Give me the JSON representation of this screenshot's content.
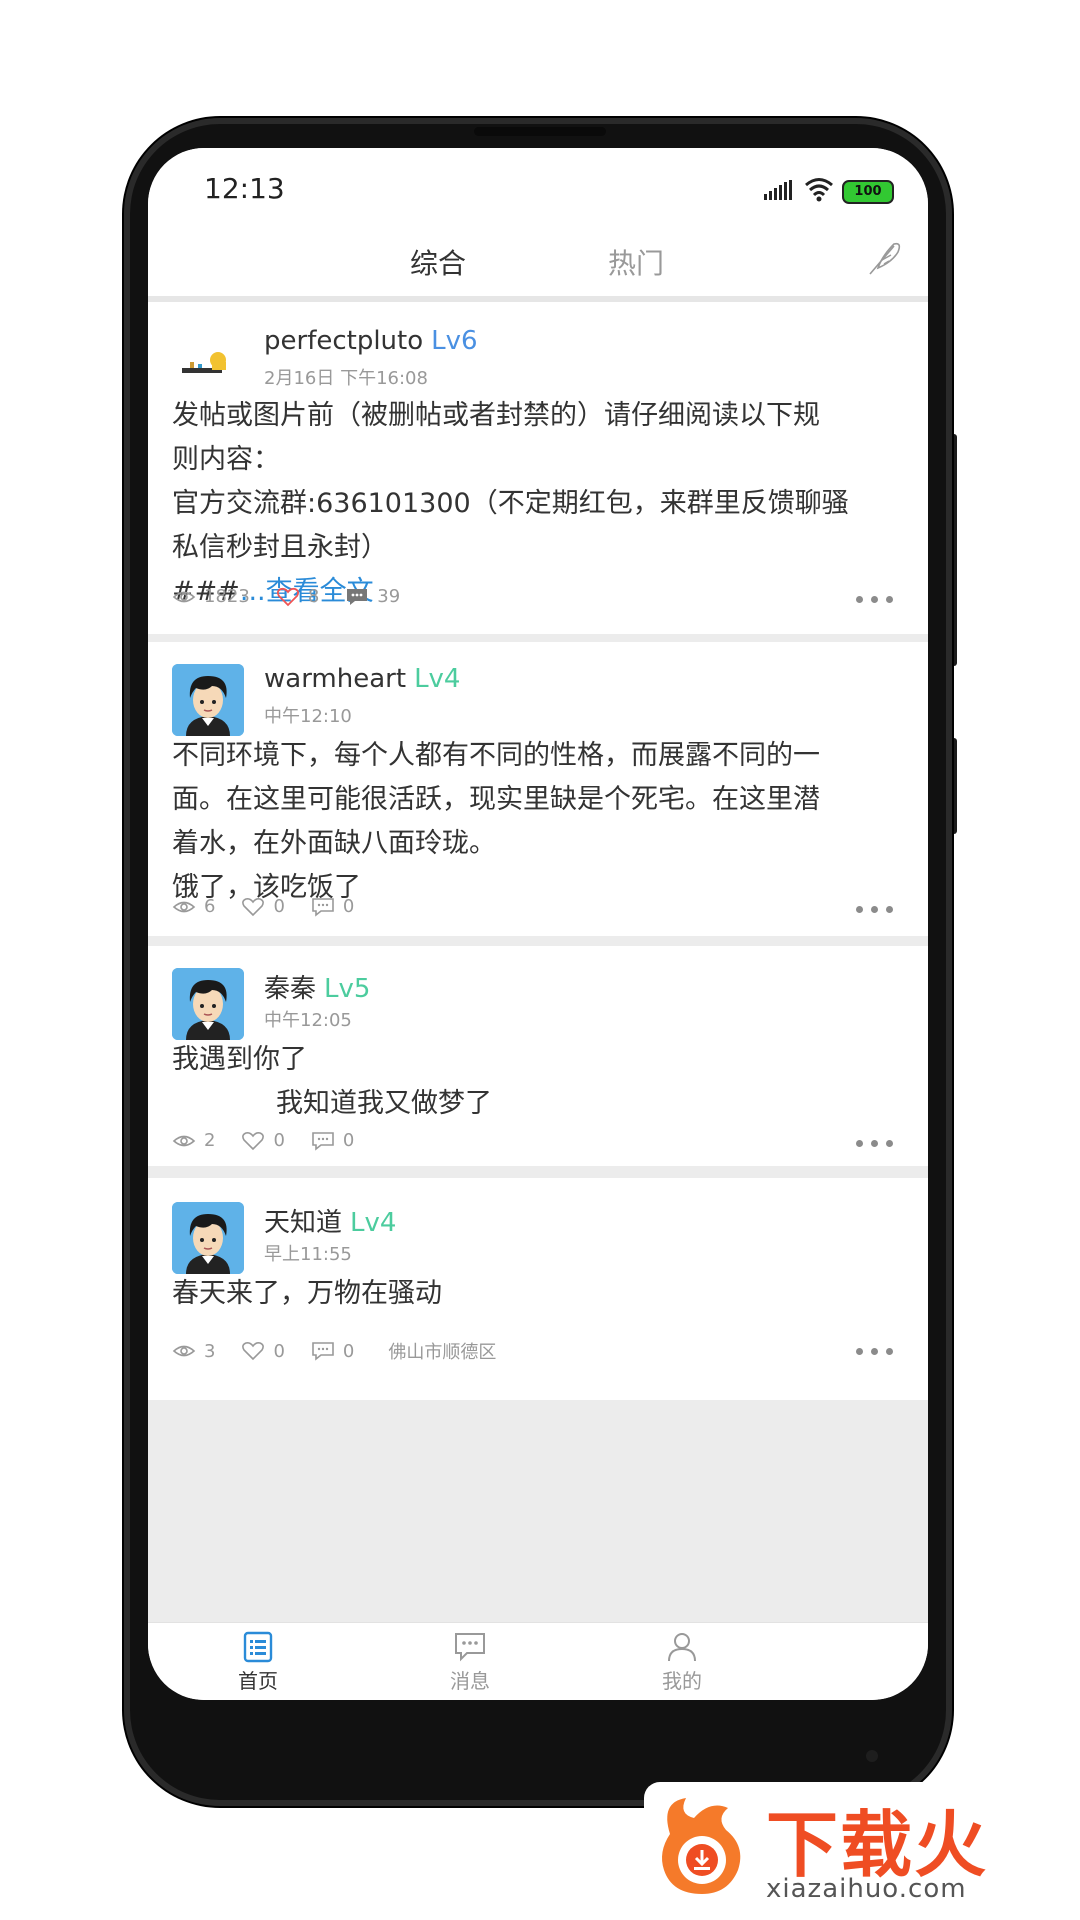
{
  "status": {
    "time": "12:13",
    "battery": "100"
  },
  "tabs": {
    "active": "综合",
    "inactive": "热门"
  },
  "posts": [
    {
      "username": "perfectpluto",
      "level": "Lv6",
      "time": "2月16日 下午16:08",
      "lines": [
        "发帖或图片前（被删帖或者封禁的）请仔细阅读以下规",
        "则内容：",
        "官方交流群:636101300（不定期红包，来群里反馈聊骚",
        "私信秒封且永封）"
      ],
      "last_prefix": "###",
      "more": "...查看全文",
      "views": "1823",
      "likes": "8",
      "comments": "39"
    },
    {
      "username": "warmheart",
      "level": "Lv4",
      "time": "中午12:10",
      "lines": [
        "不同环境下，每个人都有不同的性格，而展露不同的一",
        "面。在这里可能很活跃，现实里缺是个死宅。在这里潜",
        "着水，在外面缺八面玲珑。",
        "饿了，该吃饭了"
      ],
      "views": "6",
      "likes": "0",
      "comments": "0"
    },
    {
      "username": "秦秦",
      "level": "Lv5",
      "time": "中午12:05",
      "lines": [
        "我遇到你了",
        "我知道我又做梦了"
      ],
      "views": "2",
      "likes": "0",
      "comments": "0"
    },
    {
      "username": "天知道",
      "level": "Lv4",
      "time": "早上11:55",
      "lines": [
        "春天来了，万物在骚动"
      ],
      "views": "3",
      "likes": "0",
      "comments": "0",
      "location": "佛山市顺德区"
    }
  ],
  "bottom_nav": {
    "home": "首页",
    "messages": "消息",
    "me": "我的"
  },
  "watermark": {
    "title": "下载火",
    "url": "xiazaihuo.com"
  },
  "icons": [
    "signal-icon",
    "wifi-icon",
    "battery-icon",
    "feather-icon",
    "eye-icon",
    "heart-icon",
    "comment-icon",
    "more-icon",
    "home-list-icon",
    "message-icon",
    "user-icon"
  ],
  "colors": {
    "accent_blue": "#2a8bd8",
    "level_blue": "#4a90e2",
    "level_green": "#4ccc9e",
    "heart_red": "#f05454",
    "watermark_orange": "#ef4d23"
  }
}
